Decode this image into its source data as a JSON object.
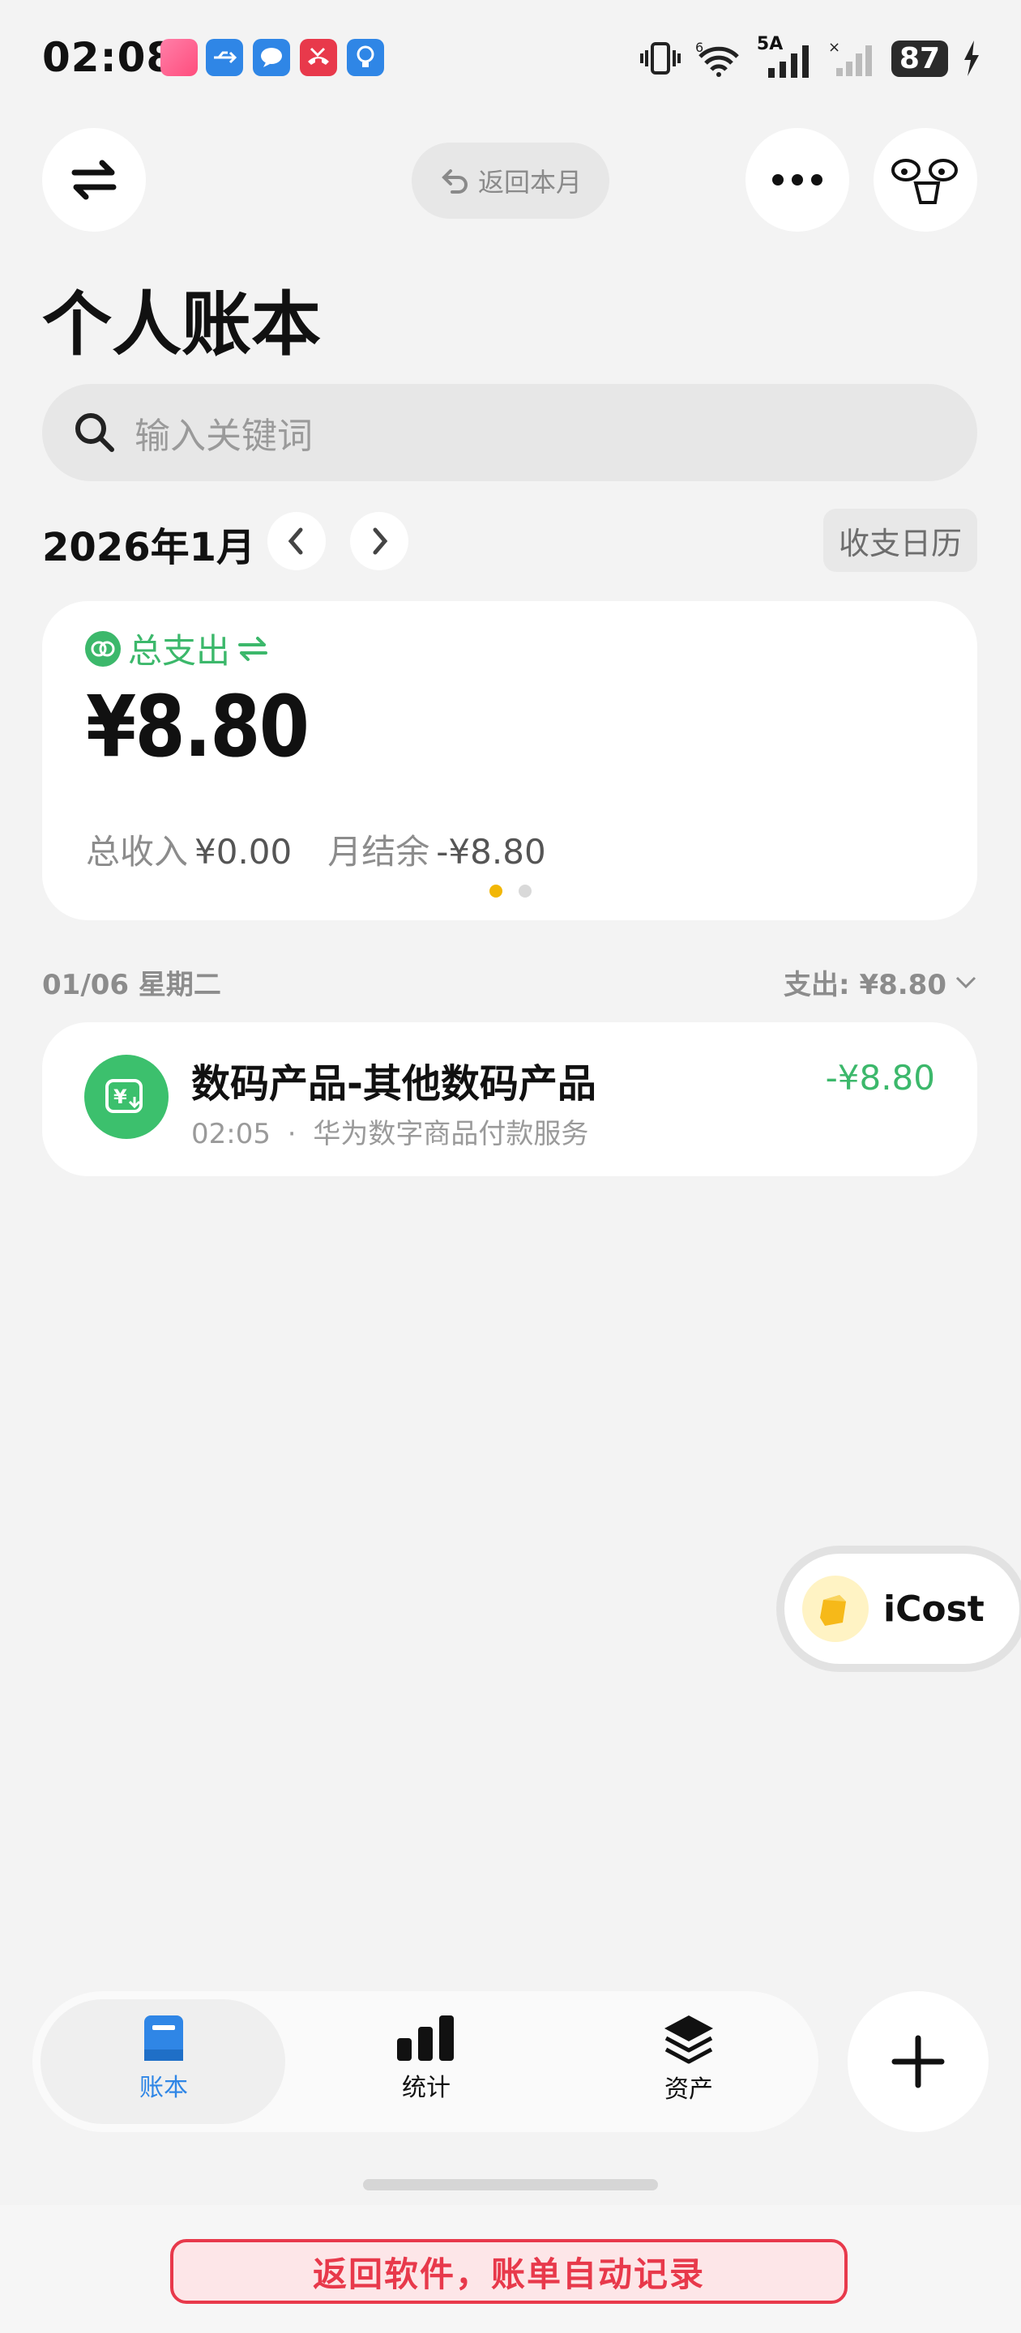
{
  "status_bar": {
    "time": "02:08",
    "network": "5A",
    "battery": "87",
    "icons": [
      "app-notification-icon",
      "usb-icon",
      "message-icon",
      "missed-call-icon",
      "bulb-icon",
      "vibrate-icon",
      "wifi-icon",
      "signal-icon",
      "no-signal-icon",
      "charging-icon"
    ]
  },
  "header": {
    "return_month": "返回本月",
    "title": "个人账本"
  },
  "search": {
    "placeholder": "输入关键词"
  },
  "month_nav": {
    "label": "2026年1月",
    "calendar_button": "收支日历"
  },
  "summary": {
    "expense_label": "总支出",
    "expense_amount": "¥8.80",
    "income_label": "总收入",
    "income_value": "¥0.00",
    "balance_label": "月结余",
    "balance_value": "-¥8.80",
    "colors": {
      "accent": "#3cb86b",
      "dot_active": "#f2b705",
      "dot_inactive": "#d9d9d9"
    }
  },
  "day_group": {
    "date": "01/06 星期二",
    "expense": "支出: ¥8.80"
  },
  "transactions": [
    {
      "title": "数码产品-其他数码产品",
      "time": "02:05",
      "separator": "·",
      "merchant": "华为数字商品付款服务",
      "amount": "-¥8.80"
    }
  ],
  "floating": {
    "label": "iCost"
  },
  "tabbar": {
    "tabs": [
      {
        "label": "账本",
        "icon": "ledger-icon",
        "active": true
      },
      {
        "label": "统计",
        "icon": "bar-chart-icon",
        "active": false
      },
      {
        "label": "资产",
        "icon": "layers-icon",
        "active": false
      }
    ],
    "active_color": "#2f86e6"
  },
  "bottom_banner": {
    "label": "返回软件，账单自动记录",
    "color": "#e8394b"
  }
}
